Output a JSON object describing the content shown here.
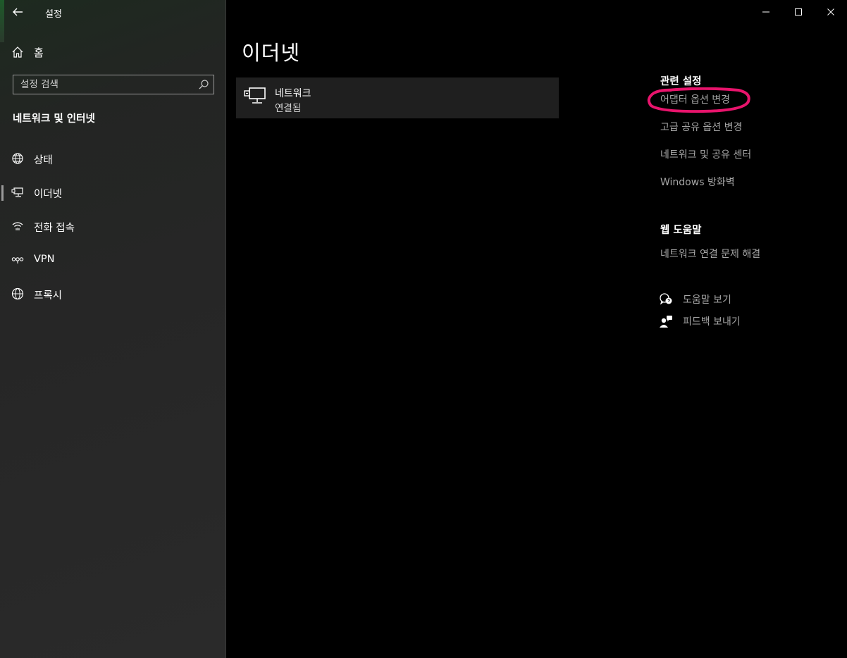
{
  "window": {
    "title": "설정",
    "controls": [
      "minimize-icon",
      "maximize-icon",
      "close-icon"
    ]
  },
  "sidebar": {
    "home_label": "홈",
    "search_placeholder": "설정 검색",
    "section_title": "네트워크 및 인터넷",
    "items": [
      {
        "label": "상태",
        "icon": "status-globe-icon",
        "selected": false
      },
      {
        "label": "이더넷",
        "icon": "ethernet-icon",
        "selected": true
      },
      {
        "label": "전화 접속",
        "icon": "dialup-icon",
        "selected": false
      },
      {
        "label": "VPN",
        "icon": "vpn-icon",
        "selected": false
      },
      {
        "label": "프록시",
        "icon": "proxy-globe-icon",
        "selected": false
      }
    ]
  },
  "main": {
    "page_title": "이더넷",
    "network": {
      "name": "네트워크",
      "status": "연결됨",
      "icon": "ethernet-monitor-icon"
    }
  },
  "related": {
    "heading": "관련 설정",
    "links": [
      "어댑터 옵션 변경",
      "고급 공유 옵션 변경",
      "네트워크 및 공유 센터",
      "Windows 방화벽"
    ],
    "web_help_heading": "웹 도움말",
    "web_help_links": [
      "네트워크 연결 문제 해결"
    ],
    "get_help": "도움말 보기",
    "feedback": "피드백 보내기"
  },
  "annotation": {
    "shape": "circle",
    "color": "#e8146c",
    "target": "어댑터 옵션 변경"
  }
}
